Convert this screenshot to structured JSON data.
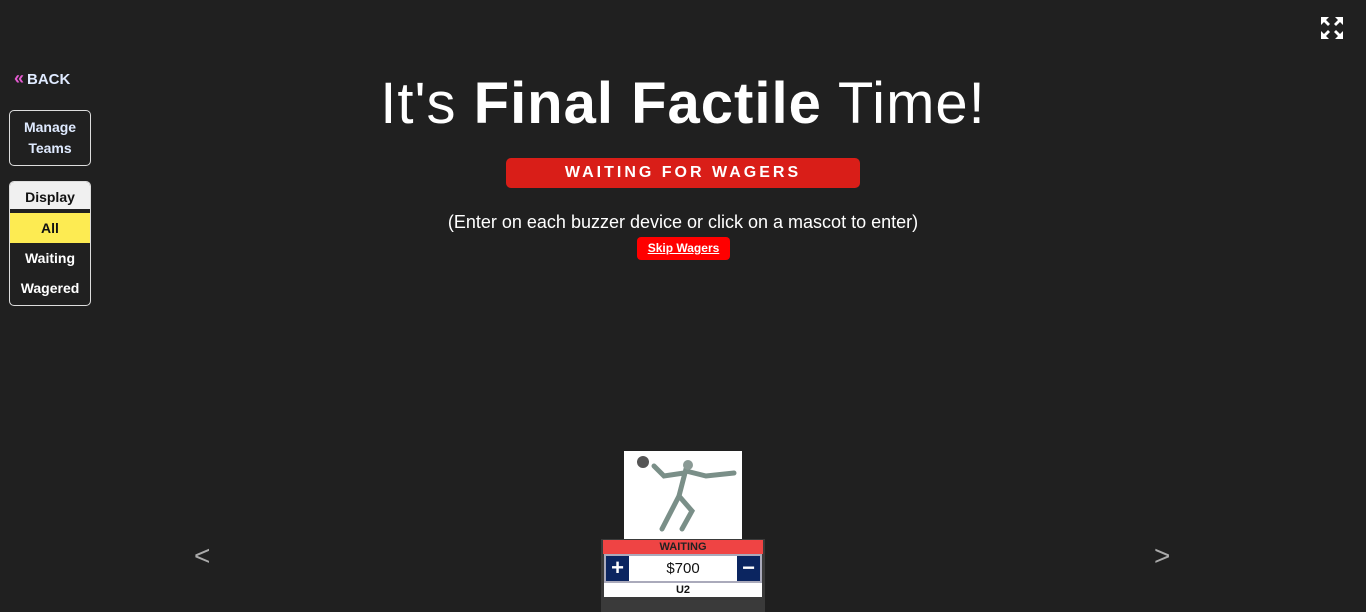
{
  "nav": {
    "back_label": "BACK",
    "manage_teams": "Manage Teams"
  },
  "display": {
    "header": "Display",
    "options": [
      "All",
      "Waiting",
      "Wagered"
    ],
    "selected": "All"
  },
  "main": {
    "title_pre": "It's ",
    "title_bold": "Final Factile",
    "title_post": " Time!",
    "status": "WAITING FOR WAGERS",
    "instructions": "(Enter on each buzzer device or click on a mascot to enter)",
    "skip_label": "Skip Wagers"
  },
  "carousel": {
    "prev": "<",
    "next": ">"
  },
  "team": {
    "status": "WAITING",
    "wager": "$700",
    "name": "U2",
    "plus": "+",
    "minus": "−"
  },
  "colors": {
    "accent_red": "#d91e18",
    "selected_yellow": "#fdeb52",
    "button_navy": "#0b2560"
  }
}
